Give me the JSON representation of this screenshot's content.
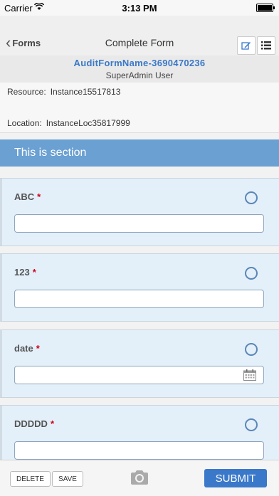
{
  "status_bar": {
    "carrier": "Carrier",
    "time": "3:13 PM"
  },
  "nav": {
    "back_label": "Forms",
    "title": "Complete Form",
    "icons": [
      "edit-icon",
      "list-icon"
    ]
  },
  "form": {
    "name": "AuditFormName-3690470236",
    "user": "SuperAdmin User",
    "resource_label": "Resource:",
    "resource_value": "Instance15517813",
    "location_label": "Location:",
    "location_value": "InstanceLoc35817999"
  },
  "section": {
    "title": "This is section"
  },
  "questions": [
    {
      "label": "ABC",
      "required": "*",
      "value": ""
    },
    {
      "label": "123",
      "required": "*",
      "value": ""
    },
    {
      "label": "date",
      "required": "*",
      "value": "",
      "icon": "calendar-icon"
    },
    {
      "label": "DDDDD",
      "required": "*",
      "value": ""
    }
  ],
  "toolbar": {
    "delete_label": "DELETE",
    "save_label": "SAVE",
    "submit_label": "SUBMIT",
    "camera_icon": "camera-icon"
  },
  "colors": {
    "accent": "#3a78c9",
    "section": "#6aa0d2",
    "card": "#e3eff9",
    "required": "#d0021b"
  }
}
